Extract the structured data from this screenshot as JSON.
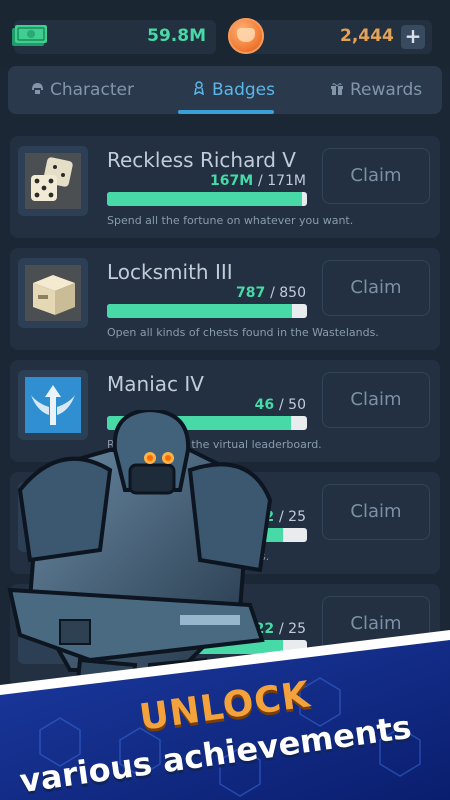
{
  "currency": {
    "cash_icon": "cash-bills-icon",
    "cash_value": "59.8M",
    "coin_icon": "coin-icon",
    "coin_value": "2,444",
    "add_label": "+"
  },
  "tabs": [
    {
      "label": "Character",
      "icon": "helmet-icon",
      "active": false
    },
    {
      "label": "Badges",
      "icon": "badge-icon",
      "active": true
    },
    {
      "label": "Rewards",
      "icon": "gift-icon",
      "active": false
    }
  ],
  "badges": [
    {
      "title": "Reckless Richard V",
      "current": "167M",
      "total": "171M",
      "fraction": 0.977,
      "description": "Spend all the fortune on whatever you want.",
      "claim_label": "Claim",
      "icon": "dice-icon"
    },
    {
      "title": "Locksmith III",
      "current": "787",
      "total": "850",
      "fraction": 0.926,
      "description": "Open all kinds of chests found in the Wastelands.",
      "claim_label": "Claim",
      "icon": "crate-icon"
    },
    {
      "title": "Maniac IV",
      "current": "46",
      "total": "50",
      "fraction": 0.92,
      "description": "Re els to climb the virtual leaderboard.",
      "claim_label": "Claim",
      "icon": "winged-arrow-icon"
    },
    {
      "title": "",
      "current": "2",
      "total": "25",
      "fraction": 0.88,
      "description": "s.",
      "claim_label": "Claim",
      "icon": "hidden-icon"
    },
    {
      "title": "",
      "current": "22",
      "total": "25",
      "fraction": 0.88,
      "description": "",
      "claim_label": "Claim",
      "icon": "hidden-icon"
    }
  ],
  "promo": {
    "headline": "UNLOCK",
    "subline": "various achievements"
  },
  "colors": {
    "accent_green": "#47d9a6",
    "accent_blue": "#3b9fd8",
    "coin_text": "#e3a35a",
    "headline_orange": "#f4a23b"
  }
}
